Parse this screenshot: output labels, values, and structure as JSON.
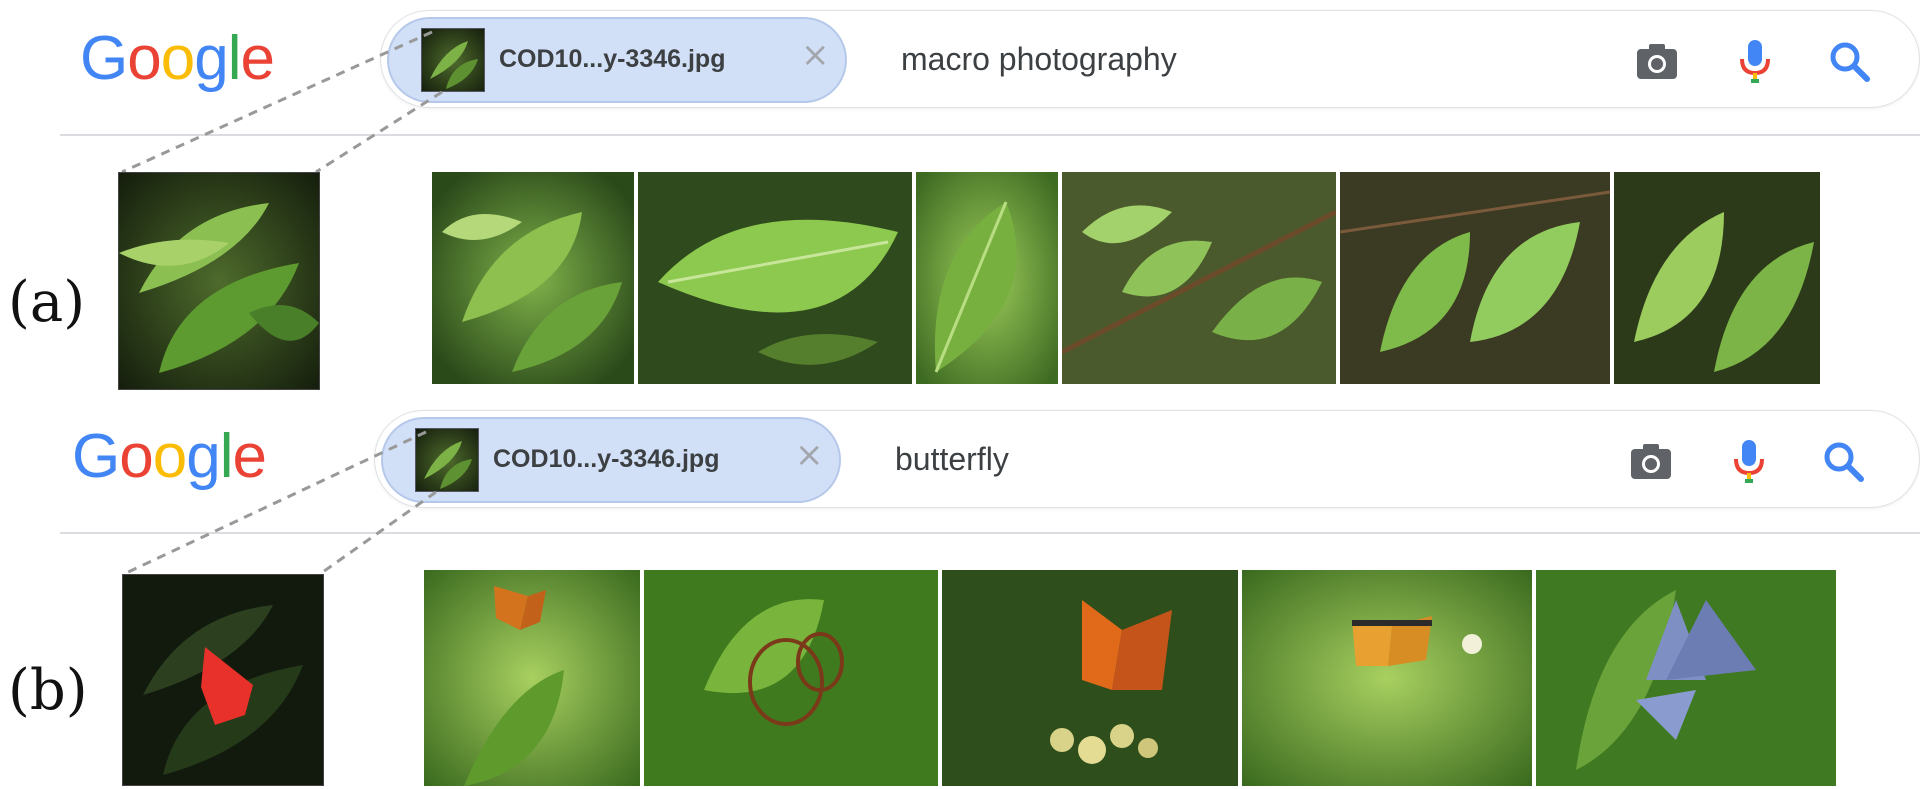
{
  "logo": {
    "letters": [
      "G",
      "o",
      "o",
      "g",
      "l",
      "e"
    ],
    "colors": [
      "#4285F4",
      "#EA4335",
      "#FBBC05",
      "#4285F4",
      "#34A853",
      "#EA4335"
    ]
  },
  "panels": [
    {
      "label": "(a)",
      "chip": {
        "filename": "COD10...y-3346.jpg",
        "close": "×"
      },
      "query": "macro photography",
      "results": [
        "leaf-cluster",
        "leaf-single",
        "leaf-closeup",
        "leaf-branch",
        "leaf-twig",
        "leaf-serrated"
      ]
    },
    {
      "label": "(b)",
      "chip": {
        "filename": "COD10...y-3346.jpg",
        "close": "×"
      },
      "query": "butterfly",
      "results": [
        "monarch-butterfly",
        "glasswing-butterfly",
        "orange-butterfly",
        "painted-butterfly",
        "blue-butterfly"
      ]
    }
  ],
  "icons": [
    "camera-icon",
    "microphone-icon",
    "search-icon"
  ],
  "colors": {
    "chip_bg": "#d2e0f7",
    "text": "#3c4043",
    "icon_gray": "#5f6368",
    "search_blue": "#4285F4",
    "mask_red": "#e8312a"
  }
}
